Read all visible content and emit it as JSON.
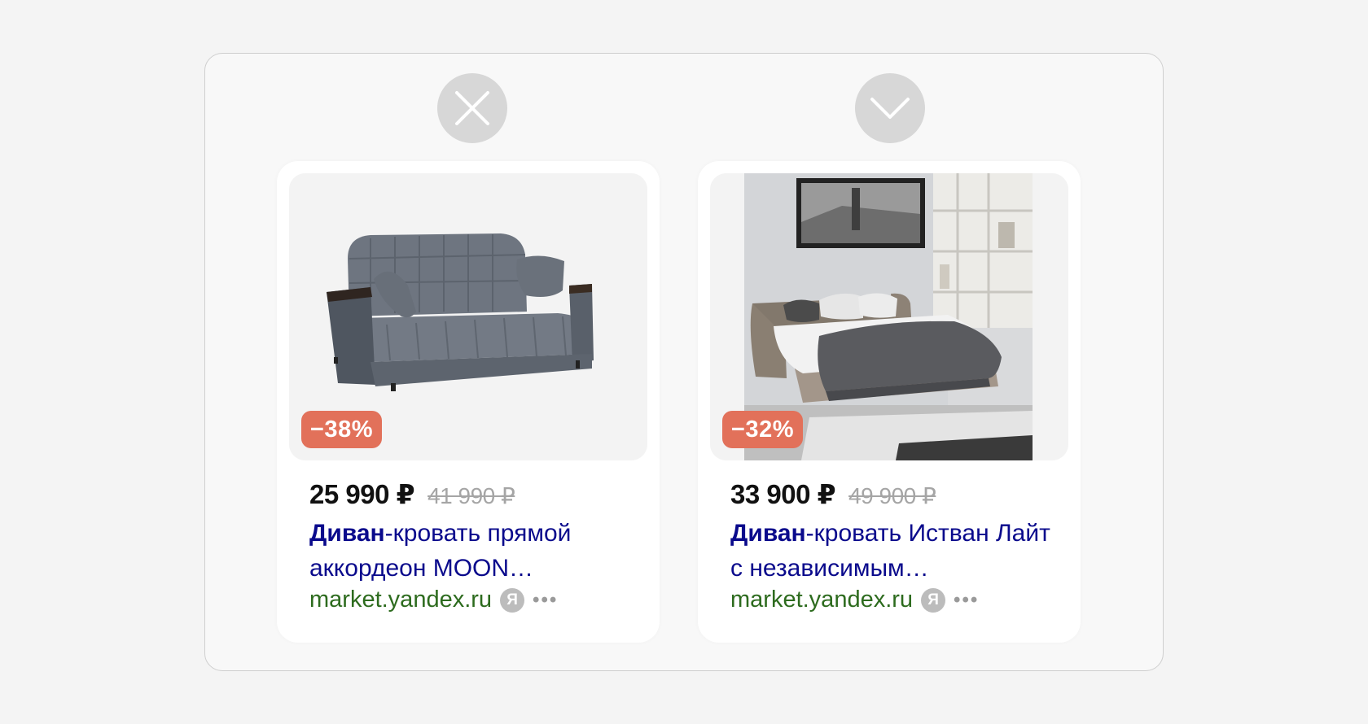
{
  "verdicts": {
    "bad_icon": "close-icon",
    "good_icon": "checkmark-icon"
  },
  "cards": [
    {
      "discount": "−38%",
      "price_now": "25 990 ₽",
      "price_old": "41 990 ₽",
      "title_bold": "Диван",
      "title_rest": "-кровать прямой аккордеон MOON…",
      "domain": "market.yandex.ru",
      "badge": "Я",
      "more": "•••"
    },
    {
      "discount": "−32%",
      "price_now": "33 900 ₽",
      "price_old": "49 900 ₽",
      "title_bold": "Диван",
      "title_rest": "-кровать Истван Лайт с независимым…",
      "domain": "market.yandex.ru",
      "badge": "Я",
      "more": "•••"
    }
  ],
  "colors": {
    "discount": "#e2715a",
    "link": "#0a0a8c",
    "domain": "#2d6b1e",
    "verdict": "#d7d7d7"
  }
}
